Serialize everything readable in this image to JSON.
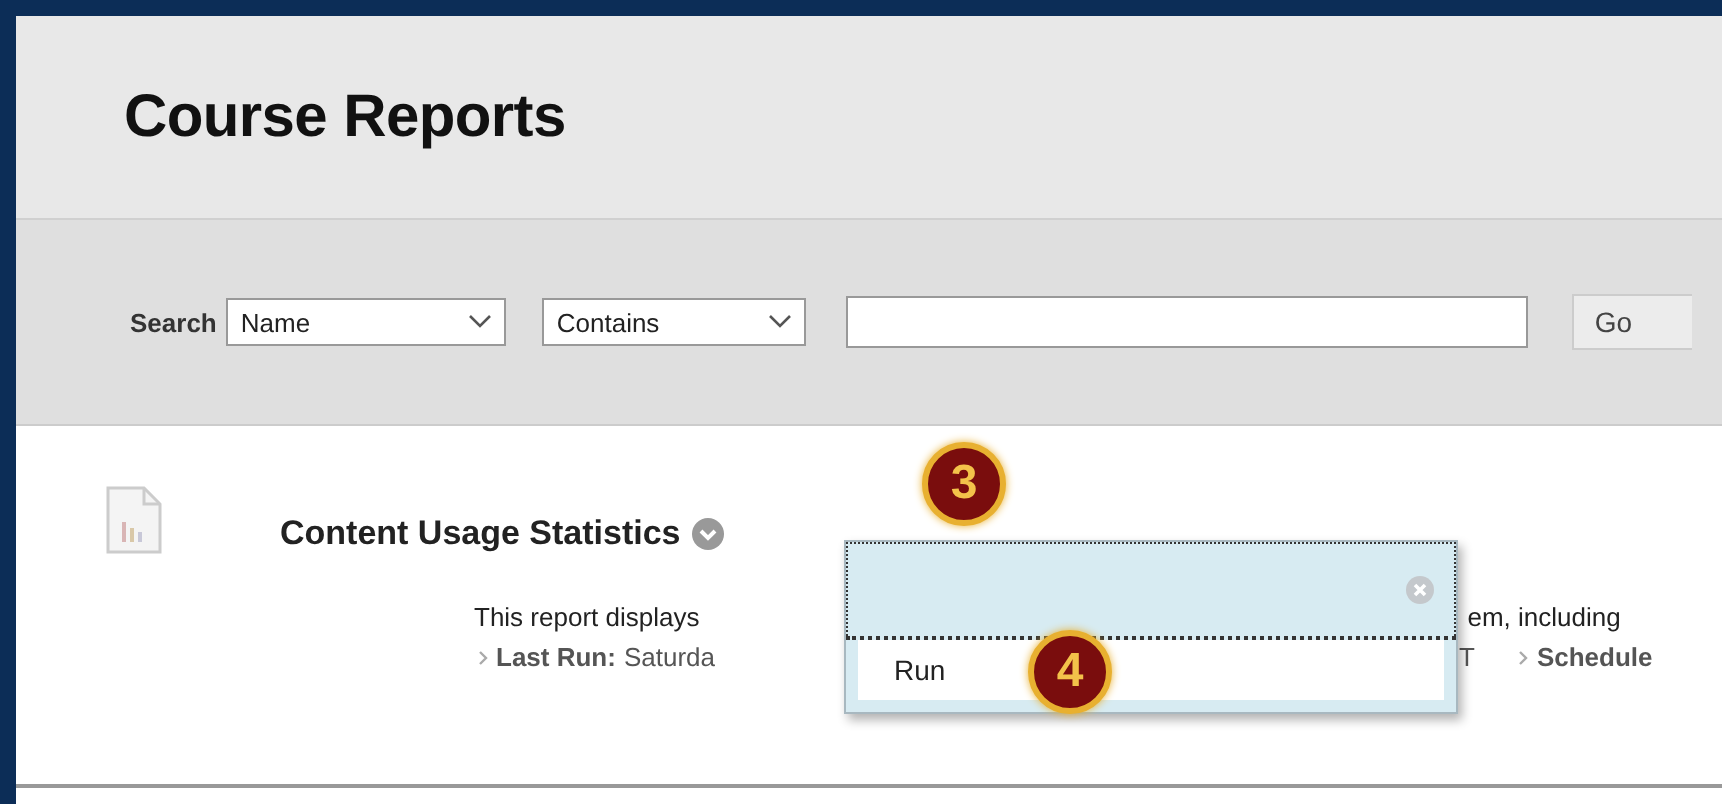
{
  "page": {
    "title": "Course Reports"
  },
  "search": {
    "label": "Search",
    "field_select": "Name",
    "operator_select": "Contains",
    "go_button": "Go"
  },
  "report": {
    "title": "Content Usage Statistics",
    "description_start": "This report displays",
    "description_end": "em, including",
    "last_run_label": "Last Run:",
    "last_run_value": "Saturda",
    "last_run_tail": "T",
    "schedule_link": "Schedule"
  },
  "menu": {
    "items": [
      {
        "label": "Run"
      }
    ]
  },
  "step_badges": [
    {
      "number": "3"
    },
    {
      "number": "4"
    }
  ]
}
